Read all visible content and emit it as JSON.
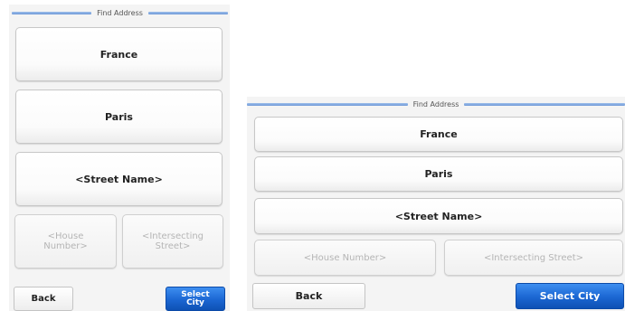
{
  "title": "Find Address",
  "fields": {
    "country": "France",
    "city": "Paris",
    "street": "<Street Name>"
  },
  "left_screen": {
    "house_number": "<House\nNumber>",
    "intersecting_street": "<Intersecting\nStreet>",
    "back": "Back",
    "select": "Select\nCity"
  },
  "right_screen": {
    "house_number": "<House Number>",
    "intersecting_street": "<Intersecting Street>",
    "back": "Back",
    "select": "Select City"
  },
  "colors": {
    "accent_blue": "#1b66d2",
    "title_line": "#6d97d6"
  }
}
